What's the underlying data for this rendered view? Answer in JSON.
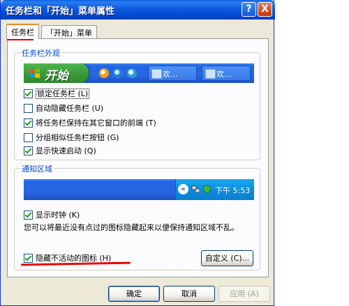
{
  "window": {
    "title": "任务栏和「开始」菜单属性",
    "help_label": "?",
    "close_label": "X"
  },
  "tabs": [
    {
      "label": "任务栏",
      "active": true
    },
    {
      "label": "「开始」菜单",
      "active": false
    }
  ],
  "taskbar_appearance": {
    "title": "任务栏外观",
    "start_label": "开始",
    "task_buttons": [
      "欢...",
      "欢..."
    ],
    "options": [
      {
        "label": "锁定任务栏 (L)",
        "checked": true
      },
      {
        "label": "自动隐藏任务栏 (U)",
        "checked": false
      },
      {
        "label": "将任务栏保持在其它窗口的前端 (T)",
        "checked": true
      },
      {
        "label": "分组相似任务栏按钮 (G)",
        "checked": false
      },
      {
        "label": "显示快速启动 (Q)",
        "checked": true
      }
    ]
  },
  "notification_area": {
    "title": "通知区域",
    "chevron": "«",
    "clock_text": "下午 5:53",
    "show_clock": {
      "label": "显示时钟 (K)",
      "checked": true
    },
    "description": "您可以将最近没有点过的图标隐藏起来以便保持通知区域不乱。",
    "hide_inactive": {
      "label": "隐藏不活动的图标 (H)",
      "checked": true
    },
    "customize_label": "自定义 (C)..."
  },
  "footer": {
    "ok_label": "确定",
    "cancel_label": "取消",
    "apply_label": "应用 (A)"
  },
  "colors": {
    "title_bar": "#0a5fe0",
    "group_title": "#0046d5",
    "highlight_underline": "#ee0000"
  }
}
